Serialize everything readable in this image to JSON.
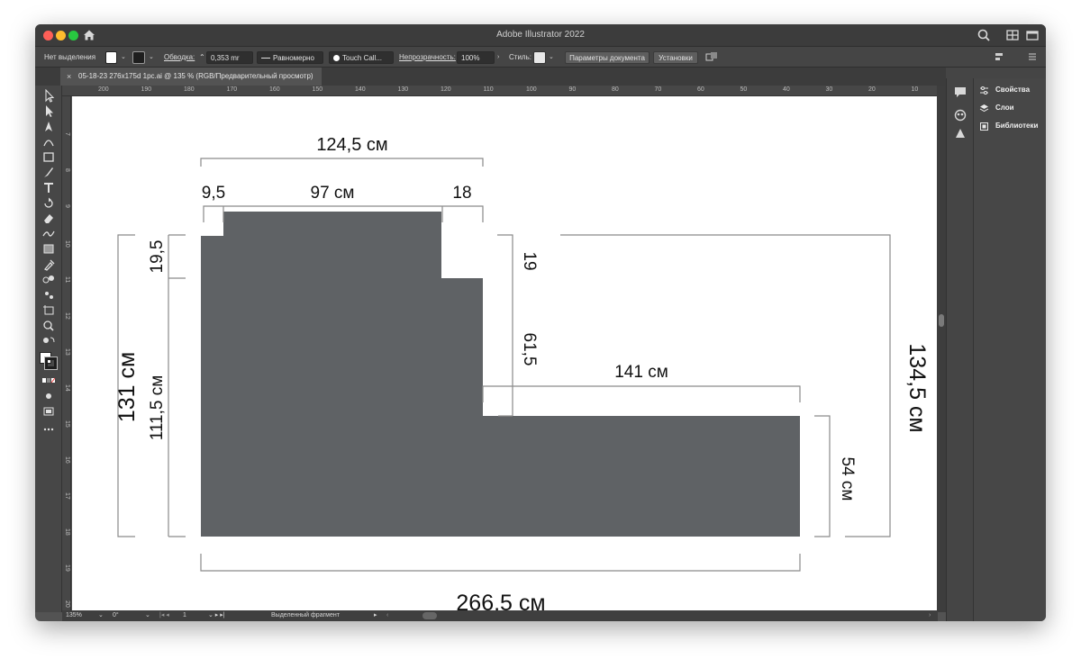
{
  "window": {
    "title": "Adobe Illustrator 2022"
  },
  "control_bar": {
    "selection_label": "Нет выделения",
    "stroke_label": "Обводка:",
    "stroke_value": "0,353 mr",
    "stroke_profile": "Равномерно",
    "brush": "Touch Call...",
    "opacity_label": "Непрозрачность:",
    "opacity_value": "100%",
    "style_label": "Стиль:",
    "doc_settings_button": "Параметры документа",
    "prefs_button": "Установки"
  },
  "document_tab": {
    "title": "05-18-23 276x175d 1pc.ai @ 135 % (RGB/Предварительный просмотр)"
  },
  "ruler": {
    "h_ticks": [
      "200",
      "190",
      "180",
      "170",
      "160",
      "150",
      "140",
      "130",
      "120",
      "110",
      "100",
      "90",
      "80",
      "70",
      "60",
      "50",
      "40",
      "30",
      "20",
      "10"
    ],
    "v_ticks": [
      "7",
      "8",
      "9",
      "10",
      "11",
      "12",
      "13",
      "14",
      "15",
      "16",
      "17",
      "18",
      "19",
      "20"
    ]
  },
  "status_bar": {
    "zoom": "135%",
    "rotation": "0°",
    "artboard": "1",
    "info": "Выделенный фрагмент"
  },
  "panels": {
    "items": [
      "Свойства",
      "Слои",
      "Библиотеки"
    ]
  },
  "drawing": {
    "shape_color": "#5f6265",
    "dim_color": "#8a8a8a",
    "labels": {
      "top_total": "124,5 см",
      "top_left": "9,5",
      "top_mid": "97 см",
      "top_right": "18",
      "left_notch": "19,5",
      "left_body": "111,5 см",
      "left_total": "131 см",
      "right_notch": "19",
      "right_step": "61,5",
      "right_top": "141 см",
      "right_low": "54 см",
      "right_total": "134,5 см",
      "bottom_total": "266,5 см"
    }
  },
  "colors": {
    "app_bg": "#535353",
    "canvas": "#ffffff",
    "panel": "#474747"
  }
}
